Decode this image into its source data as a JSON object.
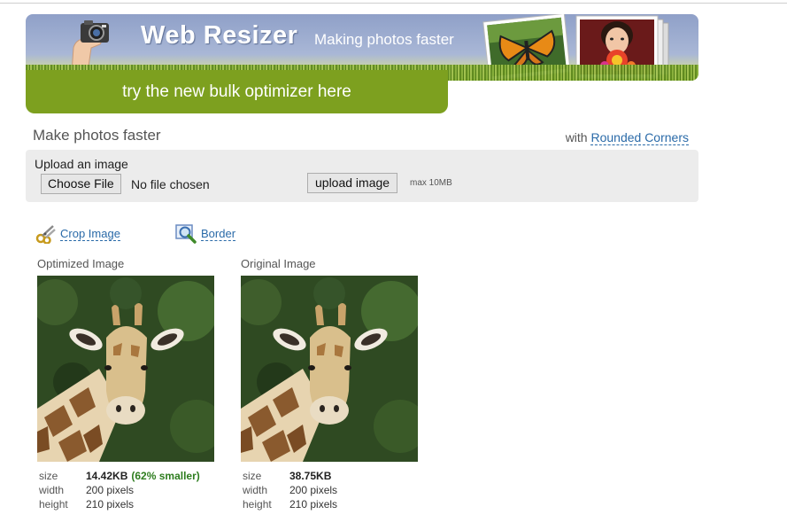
{
  "header": {
    "brand_title": "Web Resizer",
    "tagline": "Making photos faster",
    "bulk_link": "try the new bulk optimizer here"
  },
  "page": {
    "heading": "Make photos faster",
    "with_prefix": "with",
    "with_link": "Rounded Corners"
  },
  "upload": {
    "label": "Upload an image",
    "choose_file_label": "Choose File",
    "file_status": "No file chosen",
    "upload_button": "upload image",
    "max_size": "max 10MB"
  },
  "tools": {
    "crop_label": "Crop Image",
    "border_label": "Border"
  },
  "optimized": {
    "caption": "Optimized Image",
    "size_key": "size",
    "size_value": "14.42KB",
    "size_savings": "(62% smaller)",
    "width_key": "width",
    "width_value": "200 pixels",
    "height_key": "height",
    "height_value": "210 pixels"
  },
  "original": {
    "caption": "Original Image",
    "size_key": "size",
    "size_value": "38.75KB",
    "width_key": "width",
    "width_value": "200 pixels",
    "height_key": "height",
    "height_value": "210 pixels"
  },
  "colors": {
    "accent_green": "#7da01f",
    "link_blue": "#2a6aa8",
    "savings_green": "#2e7d1f",
    "panel_gray": "#ececec"
  },
  "icons": [
    "camera-hand-icon",
    "scissors-icon",
    "magnifier-border-icon"
  ]
}
